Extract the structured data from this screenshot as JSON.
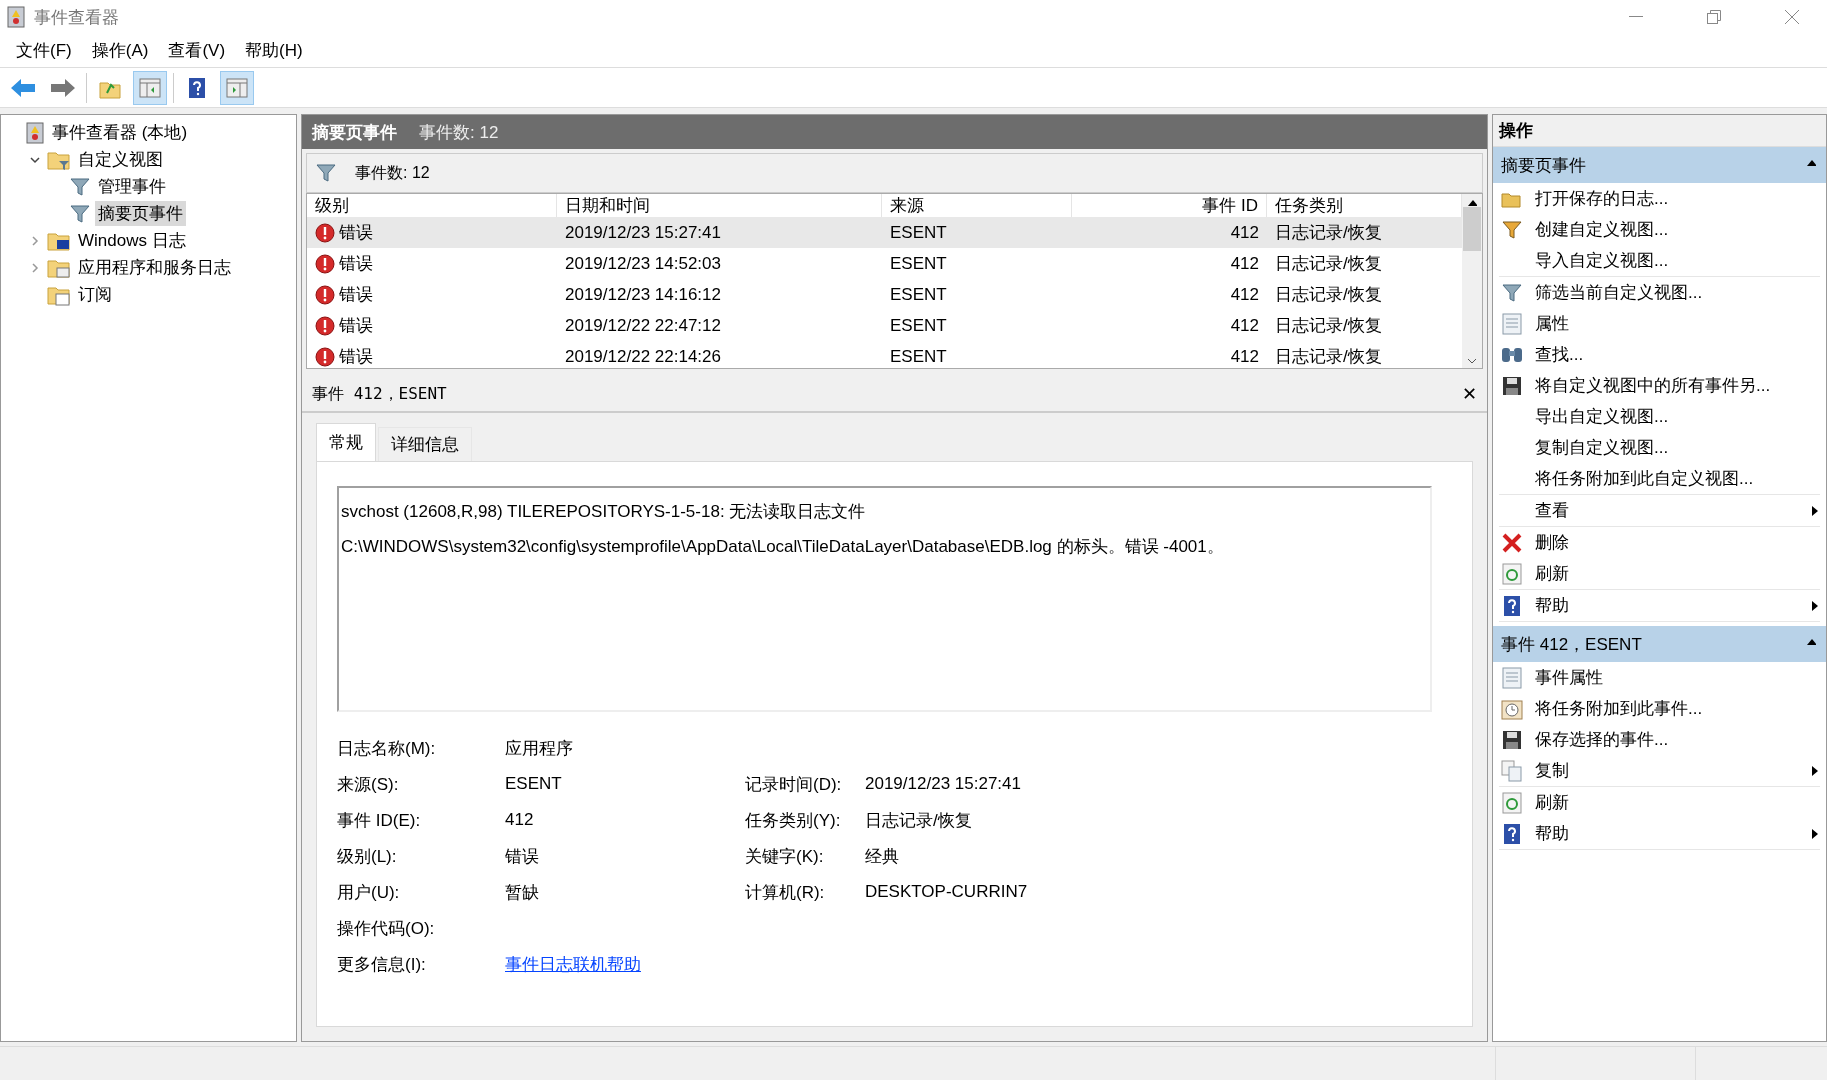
{
  "window": {
    "title": "事件查看器"
  },
  "menu": [
    "文件(F)",
    "操作(A)",
    "查看(V)",
    "帮助(H)"
  ],
  "toolbar": [
    {
      "kind": "back",
      "pressed": false
    },
    {
      "kind": "forward",
      "pressed": false
    },
    {
      "kind": "sep"
    },
    {
      "kind": "up",
      "pressed": false
    },
    {
      "kind": "tree",
      "pressed": true
    },
    {
      "kind": "sep"
    },
    {
      "kind": "help",
      "pressed": false
    },
    {
      "kind": "actions",
      "pressed": true
    }
  ],
  "tree": [
    {
      "label": "事件查看器 (本地)",
      "kind": "viewer",
      "selected": false,
      "children": [
        {
          "label": "自定义视图",
          "kind": "folder-filter",
          "selected": false,
          "expanded": true,
          "children": [
            {
              "label": "管理事件",
              "kind": "filter",
              "selected": false
            },
            {
              "label": "摘要页事件",
              "kind": "filter",
              "selected": true
            }
          ]
        },
        {
          "label": "Windows 日志",
          "kind": "folder-win",
          "selected": false,
          "expanded": false
        },
        {
          "label": "应用程序和服务日志",
          "kind": "folder-app",
          "selected": false,
          "expanded": false
        },
        {
          "label": "订阅",
          "kind": "folder-sub",
          "selected": false
        }
      ]
    }
  ],
  "center": {
    "title": "摘要页事件",
    "count": "事件数: 12",
    "filter_label": "事件数: 12",
    "columns": [
      "级别",
      "日期和时间",
      "来源",
      "事件 ID",
      "任务类别"
    ],
    "rows": [
      {
        "level": "错误",
        "date": "2019/12/23 15:27:41",
        "source": "ESENT",
        "id": "412",
        "category": "日志记录/恢复",
        "selected": true
      },
      {
        "level": "错误",
        "date": "2019/12/23 14:52:03",
        "source": "ESENT",
        "id": "412",
        "category": "日志记录/恢复",
        "selected": false
      },
      {
        "level": "错误",
        "date": "2019/12/23 14:16:12",
        "source": "ESENT",
        "id": "412",
        "category": "日志记录/恢复",
        "selected": false
      },
      {
        "level": "错误",
        "date": "2019/12/22 22:47:12",
        "source": "ESENT",
        "id": "412",
        "category": "日志记录/恢复",
        "selected": false
      },
      {
        "level": "错误",
        "date": "2019/12/22 22:14:26",
        "source": "ESENT",
        "id": "412",
        "category": "日志记录/恢复",
        "selected": false
      }
    ]
  },
  "detail": {
    "title": "事件 412，ESENT",
    "close": "✕",
    "tabs": [
      {
        "label": "常规",
        "selected": true
      },
      {
        "label": "详细信息",
        "selected": false
      }
    ],
    "message": "svchost (12608,R,98) TILEREPOSITORYS-1-5-18: 无法读取日志文件 C:\\WINDOWS\\system32\\config\\systemprofile\\AppData\\Local\\TileDataLayer\\Database\\EDB.log 的标头。错误 -4001。",
    "fields": [
      {
        "label": "日志名称(M):",
        "value": "应用程序"
      },
      {
        "label": "来源(S):",
        "value": "ESENT",
        "label2": "记录时间(D):",
        "value2": "2019/12/23 15:27:41"
      },
      {
        "label": "事件 ID(E):",
        "value": "412",
        "label2": "任务类别(Y):",
        "value2": "日志记录/恢复"
      },
      {
        "label": "级别(L):",
        "value": "错误",
        "label2": "关键字(K):",
        "value2": "经典"
      },
      {
        "label": "用户(U):",
        "value": "暂缺",
        "label2": "计算机(R):",
        "value2": "DESKTOP-CURRIN7"
      },
      {
        "label": "操作代码(O):"
      },
      {
        "label": "更多信息(I):",
        "link": "事件日志联机帮助"
      }
    ]
  },
  "actions": {
    "title": "操作",
    "sections": [
      {
        "title": "摘要页事件",
        "expanded": true,
        "groups": [
          [
            {
              "label": "打开保存的日志...",
              "kind": "open"
            },
            {
              "label": "创建自定义视图...",
              "kind": "filter-new"
            },
            {
              "label": "导入自定义视图...",
              "kind": "plain"
            }
          ],
          [
            {
              "label": "筛选当前自定义视图...",
              "kind": "filter"
            },
            {
              "label": "属性",
              "kind": "props"
            },
            {
              "label": "查找...",
              "kind": "find"
            },
            {
              "label": "将自定义视图中的所有事件另...",
              "kind": "save"
            },
            {
              "label": "导出自定义视图...",
              "kind": "plain"
            },
            {
              "label": "复制自定义视图...",
              "kind": "plain"
            },
            {
              "label": "将任务附加到此自定义视图...",
              "kind": "plain"
            }
          ],
          [
            {
              "label": "查看",
              "kind": "plain",
              "submenu": true
            }
          ],
          [
            {
              "label": "删除",
              "kind": "delete"
            },
            {
              "label": "刷新",
              "kind": "refresh"
            }
          ],
          [
            {
              "label": "帮助",
              "kind": "help",
              "submenu": true
            }
          ]
        ]
      },
      {
        "title": "事件 412，ESENT",
        "expanded": true,
        "groups": [
          [
            {
              "label": "事件属性",
              "kind": "props"
            },
            {
              "label": "将任务附加到此事件...",
              "kind": "task"
            },
            {
              "label": "保存选择的事件...",
              "kind": "save"
            },
            {
              "label": "复制",
              "kind": "copy",
              "submenu": true
            }
          ],
          [
            {
              "label": "刷新",
              "kind": "refresh"
            },
            {
              "label": "帮助",
              "kind": "help",
              "submenu": true
            }
          ]
        ]
      }
    ]
  }
}
